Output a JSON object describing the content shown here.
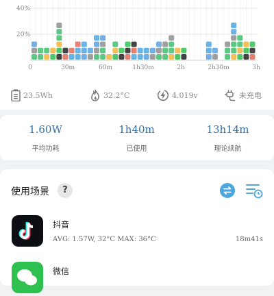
{
  "chart": {
    "y_ticks": [
      "40%",
      "20%"
    ],
    "x_ticks": [
      "0",
      "30m",
      "60m",
      "1h30m",
      "2h",
      "2h30m",
      "3h"
    ]
  },
  "stats": {
    "energy": "23.5Wh",
    "temperature": "32.2°C",
    "voltage": "4.019v",
    "charging": "未充电"
  },
  "summary": [
    {
      "value": "1.60W",
      "label": "平均功耗"
    },
    {
      "value": "1h40m",
      "label": "已使用"
    },
    {
      "value": "13h14m",
      "label": "理论续航"
    }
  ],
  "usage": {
    "title": "使用场景",
    "help": "?",
    "apps": [
      {
        "name": "抖音",
        "stats": "AVG: 1.57W, 32°C    MAX: 36°C",
        "time": "18m41s"
      },
      {
        "name": "微信",
        "stats": "",
        "time": ""
      }
    ]
  },
  "colors": {
    "accent": "#2f6fa8",
    "wechat_green": "#2fc150",
    "tiktok_black": "#0d0d14",
    "icon_blue": "#4ca6df"
  }
}
